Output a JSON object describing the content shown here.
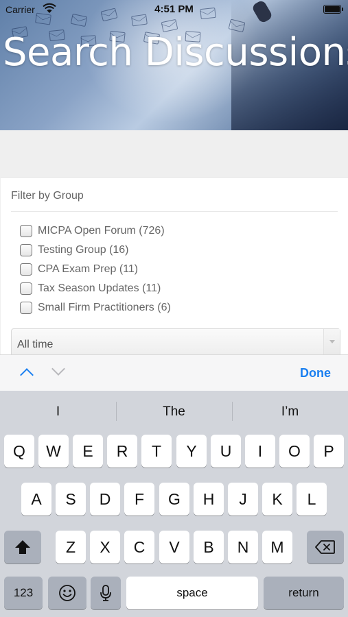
{
  "status_bar": {
    "carrier": "Carrier",
    "time": "4:51 PM"
  },
  "banner": {
    "title": "Search Discussions"
  },
  "filter": {
    "title": "Filter by Group",
    "groups": [
      {
        "label": "MICPA Open Forum (726)",
        "checked": false
      },
      {
        "label": "Testing Group (16)",
        "checked": false
      },
      {
        "label": "CPA Exam Prep (11)",
        "checked": false
      },
      {
        "label": "Tax Season Updates (11)",
        "checked": false
      },
      {
        "label": "Small Firm Practitioners (6)",
        "checked": false
      }
    ],
    "time_select": {
      "value": "All time"
    }
  },
  "accessory": {
    "done_label": "Done"
  },
  "keyboard": {
    "suggestions": [
      "I",
      "The",
      "I’m"
    ],
    "row1": [
      "Q",
      "W",
      "E",
      "R",
      "T",
      "Y",
      "U",
      "I",
      "O",
      "P"
    ],
    "row2": [
      "A",
      "S",
      "D",
      "F",
      "G",
      "H",
      "J",
      "K",
      "L"
    ],
    "row3": [
      "Z",
      "X",
      "C",
      "V",
      "B",
      "N",
      "M"
    ],
    "numbers_label": "123",
    "space_label": "space",
    "return_label": "return"
  },
  "colors": {
    "accent": "#1a7ff0",
    "keyboard_bg": "#d2d5db",
    "dark_key": "#aab0bb"
  },
  "icons": [
    "wifi-icon",
    "battery-icon",
    "chevron-up-icon",
    "chevron-down-icon",
    "shift-icon",
    "delete-icon",
    "emoji-icon",
    "microphone-icon"
  ]
}
